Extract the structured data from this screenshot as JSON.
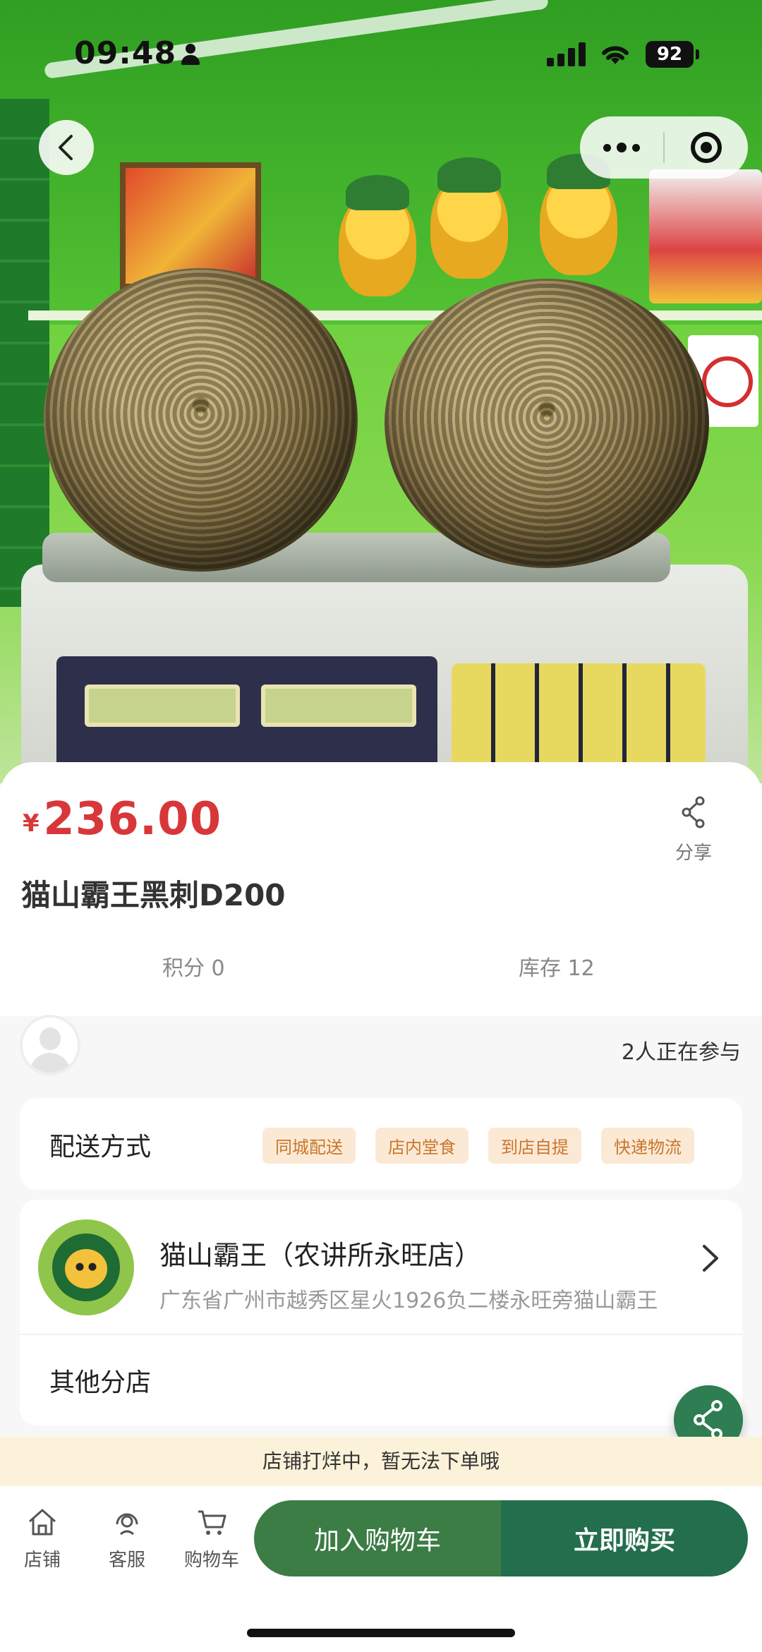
{
  "status_bar": {
    "time": "09:48",
    "battery": "92"
  },
  "product": {
    "currency": "¥",
    "price": "236.00",
    "title": "猫山霸王黑刺D200",
    "share_label": "分享",
    "points": "积分 0",
    "stock": "库存 12"
  },
  "participants": {
    "count_text": "2人正在参与"
  },
  "delivery": {
    "label": "配送方式",
    "options": [
      "同城配送",
      "店内堂食",
      "到店自提",
      "快递物流"
    ]
  },
  "store": {
    "name": "猫山霸王（农讲所永旺店）",
    "address": "广东省广州市越秀区星火1926负二楼永旺旁猫山霸王",
    "other_branches": "其他分店"
  },
  "notice": "店铺打烊中，暂无法下单哦",
  "bottom_nav": {
    "store": "店铺",
    "service": "客服",
    "cart": "购物车",
    "add_to_cart": "加入购物车",
    "buy_now": "立即购买"
  },
  "colors": {
    "price_red": "#d8373a",
    "brand_green": "#236e4c",
    "cart_green": "#3c7c45",
    "tag_bg": "#fbe9d6",
    "tag_text": "#c9772a",
    "notice_bg": "#fbf2d9"
  },
  "icons": {
    "back": "chevron-left-icon",
    "more": "more-dots-icon",
    "miniapp_close": "target-icon",
    "share": "share-icon",
    "store_arrow": "chevron-right-icon",
    "home": "home-icon",
    "service": "headset-icon",
    "cart": "cart-icon"
  }
}
